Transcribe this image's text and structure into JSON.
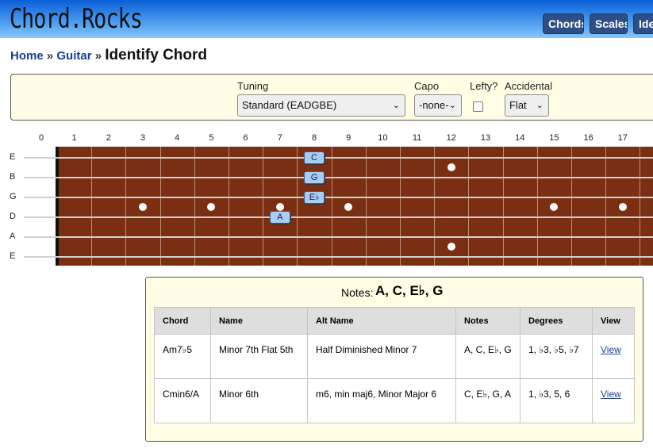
{
  "header": {
    "logo": "Chord.Rocks",
    "nav": [
      "Chords",
      "Scales",
      "Iden"
    ]
  },
  "breadcrumb": {
    "home": "Home",
    "guitar": "Guitar",
    "sep": "»",
    "current": "Identify Chord"
  },
  "controls": {
    "tuning": {
      "label": "Tuning",
      "value": "Standard (EADGBE)"
    },
    "capo": {
      "label": "Capo",
      "value": "-none-"
    },
    "lefty": {
      "label": "Lefty?",
      "checked": false
    },
    "accidental": {
      "label": "Accidental",
      "value": "Flat"
    }
  },
  "fretboard": {
    "fret_numbers": [
      "0",
      "1",
      "2",
      "3",
      "4",
      "5",
      "6",
      "7",
      "8",
      "9",
      "10",
      "11",
      "12",
      "13",
      "14",
      "15",
      "16",
      "17"
    ],
    "strings": [
      "E",
      "B",
      "G",
      "D",
      "A",
      "E"
    ],
    "selected_notes": [
      {
        "string": "E",
        "fret": 8,
        "label": "C"
      },
      {
        "string": "B",
        "fret": 8,
        "label": "G"
      },
      {
        "string": "G",
        "fret": 8,
        "label": "E♭"
      },
      {
        "string": "D",
        "fret": 7,
        "label": "A"
      }
    ]
  },
  "results": {
    "notes_label": "Notes:",
    "notes_value": "A, C, E♭, G",
    "columns": [
      "Chord",
      "Name",
      "Alt Name",
      "Notes",
      "Degrees",
      "View"
    ],
    "rows": [
      {
        "chord": "Am7♭5",
        "name": "Minor 7th Flat 5th",
        "alt": "Half Diminished Minor 7",
        "notes": "A, C, E♭, G",
        "degrees": "1, ♭3, ♭5, ♭7",
        "view": "View"
      },
      {
        "chord": "Cmin6/A",
        "name": "Minor 6th",
        "alt": "m6, min maj6, Minor Major 6",
        "notes": "C, E♭, G, A",
        "degrees": "1, ♭3, 5, 6",
        "view": "View"
      }
    ]
  },
  "colors": {
    "header_top": "#0a5fd6",
    "nav_button": "#2d4f85",
    "fretboard": "#7a2e12",
    "note_marker": "#a9ccf3",
    "panel_bg": "#fffde3",
    "link": "#1a3f8e"
  }
}
